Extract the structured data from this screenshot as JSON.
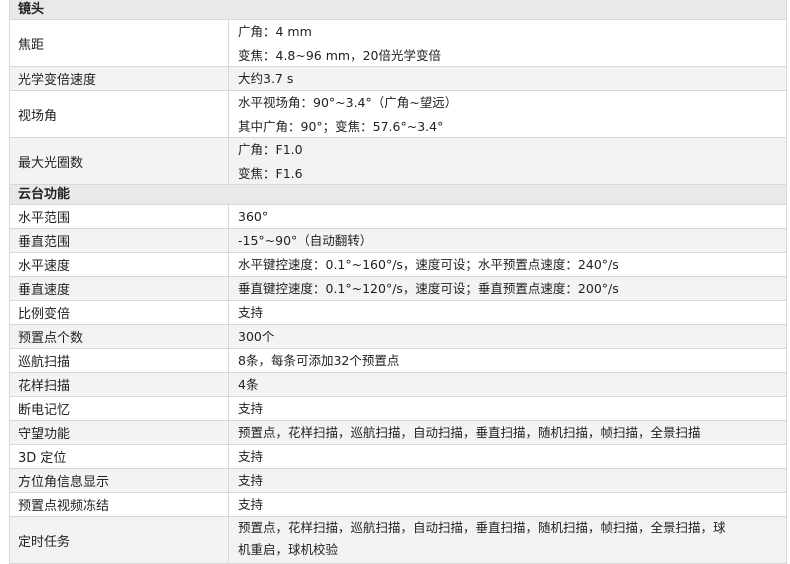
{
  "sections": [
    {
      "title": "镜头",
      "rows": [
        {
          "label": "焦距",
          "lines": [
            "广角：4 mm",
            "变焦：4.8~96 mm，20倍光学变倍"
          ]
        },
        {
          "label": "光学变倍速度",
          "lines": [
            "大约3.7 s"
          ]
        },
        {
          "label": "视场角",
          "lines": [
            "水平视场角：90°~3.4°（广角~望远）",
            "其中广角：90°；变焦：57.6°~3.4°"
          ]
        },
        {
          "label": "最大光圈数",
          "lines": [
            "广角：F1.0",
            "变焦：F1.6"
          ]
        }
      ]
    },
    {
      "title": "云台功能",
      "rows": [
        {
          "label": "水平范围",
          "lines": [
            "360°"
          ]
        },
        {
          "label": "垂直范围",
          "lines": [
            "-15°~90°（自动翻转）"
          ]
        },
        {
          "label": "水平速度",
          "lines": [
            "水平键控速度：0.1°~160°/s，速度可设；水平预置点速度：240°/s"
          ]
        },
        {
          "label": "垂直速度",
          "lines": [
            "垂直键控速度：0.1°~120°/s，速度可设；垂直预置点速度：200°/s"
          ]
        },
        {
          "label": "比例变倍",
          "lines": [
            "支持"
          ]
        },
        {
          "label": "预置点个数",
          "lines": [
            "300个"
          ]
        },
        {
          "label": "巡航扫描",
          "lines": [
            "8条，每条可添加32个预置点"
          ]
        },
        {
          "label": "花样扫描",
          "lines": [
            "4条"
          ]
        },
        {
          "label": "断电记忆",
          "lines": [
            "支持"
          ]
        },
        {
          "label": "守望功能",
          "lines": [
            "预置点，花样扫描，巡航扫描，自动扫描，垂直扫描，随机扫描，帧扫描，全景扫描"
          ]
        },
        {
          "label": "3D  定位",
          "lines": [
            "支持"
          ]
        },
        {
          "label": "方位角信息显示",
          "lines": [
            "支持"
          ]
        },
        {
          "label": "预置点视频冻结",
          "lines": [
            "支持"
          ]
        },
        {
          "label": "定时任务",
          "lines": [
            "预置点，花样扫描，巡航扫描，自动扫描，垂直扫描，随机扫描，帧扫描，全景扫描，球",
            "机重启，球机校验"
          ]
        }
      ]
    }
  ]
}
